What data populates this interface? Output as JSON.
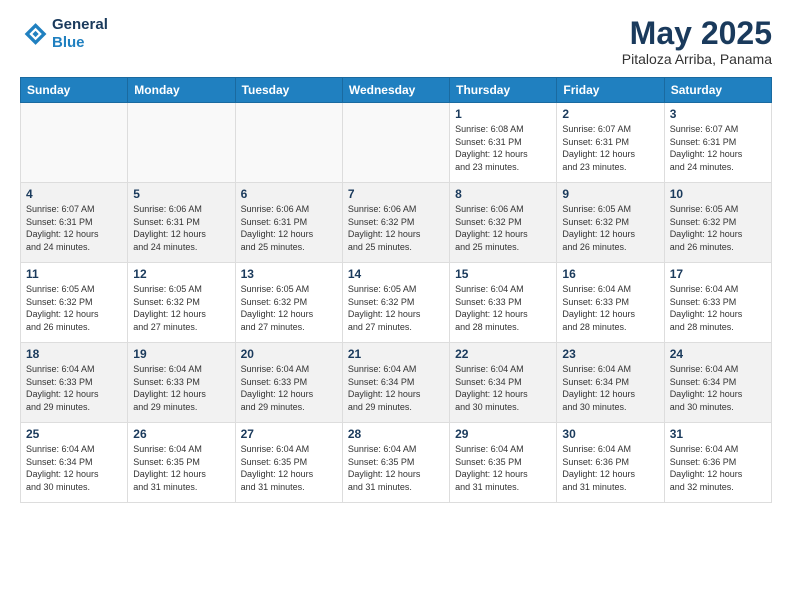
{
  "logo": {
    "line1": "General",
    "line2": "Blue"
  },
  "title": "May 2025",
  "subtitle": "Pitaloza Arriba, Panama",
  "weekdays": [
    "Sunday",
    "Monday",
    "Tuesday",
    "Wednesday",
    "Thursday",
    "Friday",
    "Saturday"
  ],
  "weeks": [
    {
      "shade": false,
      "days": [
        {
          "num": "",
          "info": ""
        },
        {
          "num": "",
          "info": ""
        },
        {
          "num": "",
          "info": ""
        },
        {
          "num": "",
          "info": ""
        },
        {
          "num": "1",
          "info": "Sunrise: 6:08 AM\nSunset: 6:31 PM\nDaylight: 12 hours\nand 23 minutes."
        },
        {
          "num": "2",
          "info": "Sunrise: 6:07 AM\nSunset: 6:31 PM\nDaylight: 12 hours\nand 23 minutes."
        },
        {
          "num": "3",
          "info": "Sunrise: 6:07 AM\nSunset: 6:31 PM\nDaylight: 12 hours\nand 24 minutes."
        }
      ]
    },
    {
      "shade": true,
      "days": [
        {
          "num": "4",
          "info": "Sunrise: 6:07 AM\nSunset: 6:31 PM\nDaylight: 12 hours\nand 24 minutes."
        },
        {
          "num": "5",
          "info": "Sunrise: 6:06 AM\nSunset: 6:31 PM\nDaylight: 12 hours\nand 24 minutes."
        },
        {
          "num": "6",
          "info": "Sunrise: 6:06 AM\nSunset: 6:31 PM\nDaylight: 12 hours\nand 25 minutes."
        },
        {
          "num": "7",
          "info": "Sunrise: 6:06 AM\nSunset: 6:32 PM\nDaylight: 12 hours\nand 25 minutes."
        },
        {
          "num": "8",
          "info": "Sunrise: 6:06 AM\nSunset: 6:32 PM\nDaylight: 12 hours\nand 25 minutes."
        },
        {
          "num": "9",
          "info": "Sunrise: 6:05 AM\nSunset: 6:32 PM\nDaylight: 12 hours\nand 26 minutes."
        },
        {
          "num": "10",
          "info": "Sunrise: 6:05 AM\nSunset: 6:32 PM\nDaylight: 12 hours\nand 26 minutes."
        }
      ]
    },
    {
      "shade": false,
      "days": [
        {
          "num": "11",
          "info": "Sunrise: 6:05 AM\nSunset: 6:32 PM\nDaylight: 12 hours\nand 26 minutes."
        },
        {
          "num": "12",
          "info": "Sunrise: 6:05 AM\nSunset: 6:32 PM\nDaylight: 12 hours\nand 27 minutes."
        },
        {
          "num": "13",
          "info": "Sunrise: 6:05 AM\nSunset: 6:32 PM\nDaylight: 12 hours\nand 27 minutes."
        },
        {
          "num": "14",
          "info": "Sunrise: 6:05 AM\nSunset: 6:32 PM\nDaylight: 12 hours\nand 27 minutes."
        },
        {
          "num": "15",
          "info": "Sunrise: 6:04 AM\nSunset: 6:33 PM\nDaylight: 12 hours\nand 28 minutes."
        },
        {
          "num": "16",
          "info": "Sunrise: 6:04 AM\nSunset: 6:33 PM\nDaylight: 12 hours\nand 28 minutes."
        },
        {
          "num": "17",
          "info": "Sunrise: 6:04 AM\nSunset: 6:33 PM\nDaylight: 12 hours\nand 28 minutes."
        }
      ]
    },
    {
      "shade": true,
      "days": [
        {
          "num": "18",
          "info": "Sunrise: 6:04 AM\nSunset: 6:33 PM\nDaylight: 12 hours\nand 29 minutes."
        },
        {
          "num": "19",
          "info": "Sunrise: 6:04 AM\nSunset: 6:33 PM\nDaylight: 12 hours\nand 29 minutes."
        },
        {
          "num": "20",
          "info": "Sunrise: 6:04 AM\nSunset: 6:33 PM\nDaylight: 12 hours\nand 29 minutes."
        },
        {
          "num": "21",
          "info": "Sunrise: 6:04 AM\nSunset: 6:34 PM\nDaylight: 12 hours\nand 29 minutes."
        },
        {
          "num": "22",
          "info": "Sunrise: 6:04 AM\nSunset: 6:34 PM\nDaylight: 12 hours\nand 30 minutes."
        },
        {
          "num": "23",
          "info": "Sunrise: 6:04 AM\nSunset: 6:34 PM\nDaylight: 12 hours\nand 30 minutes."
        },
        {
          "num": "24",
          "info": "Sunrise: 6:04 AM\nSunset: 6:34 PM\nDaylight: 12 hours\nand 30 minutes."
        }
      ]
    },
    {
      "shade": false,
      "days": [
        {
          "num": "25",
          "info": "Sunrise: 6:04 AM\nSunset: 6:34 PM\nDaylight: 12 hours\nand 30 minutes."
        },
        {
          "num": "26",
          "info": "Sunrise: 6:04 AM\nSunset: 6:35 PM\nDaylight: 12 hours\nand 31 minutes."
        },
        {
          "num": "27",
          "info": "Sunrise: 6:04 AM\nSunset: 6:35 PM\nDaylight: 12 hours\nand 31 minutes."
        },
        {
          "num": "28",
          "info": "Sunrise: 6:04 AM\nSunset: 6:35 PM\nDaylight: 12 hours\nand 31 minutes."
        },
        {
          "num": "29",
          "info": "Sunrise: 6:04 AM\nSunset: 6:35 PM\nDaylight: 12 hours\nand 31 minutes."
        },
        {
          "num": "30",
          "info": "Sunrise: 6:04 AM\nSunset: 6:36 PM\nDaylight: 12 hours\nand 31 minutes."
        },
        {
          "num": "31",
          "info": "Sunrise: 6:04 AM\nSunset: 6:36 PM\nDaylight: 12 hours\nand 32 minutes."
        }
      ]
    }
  ]
}
